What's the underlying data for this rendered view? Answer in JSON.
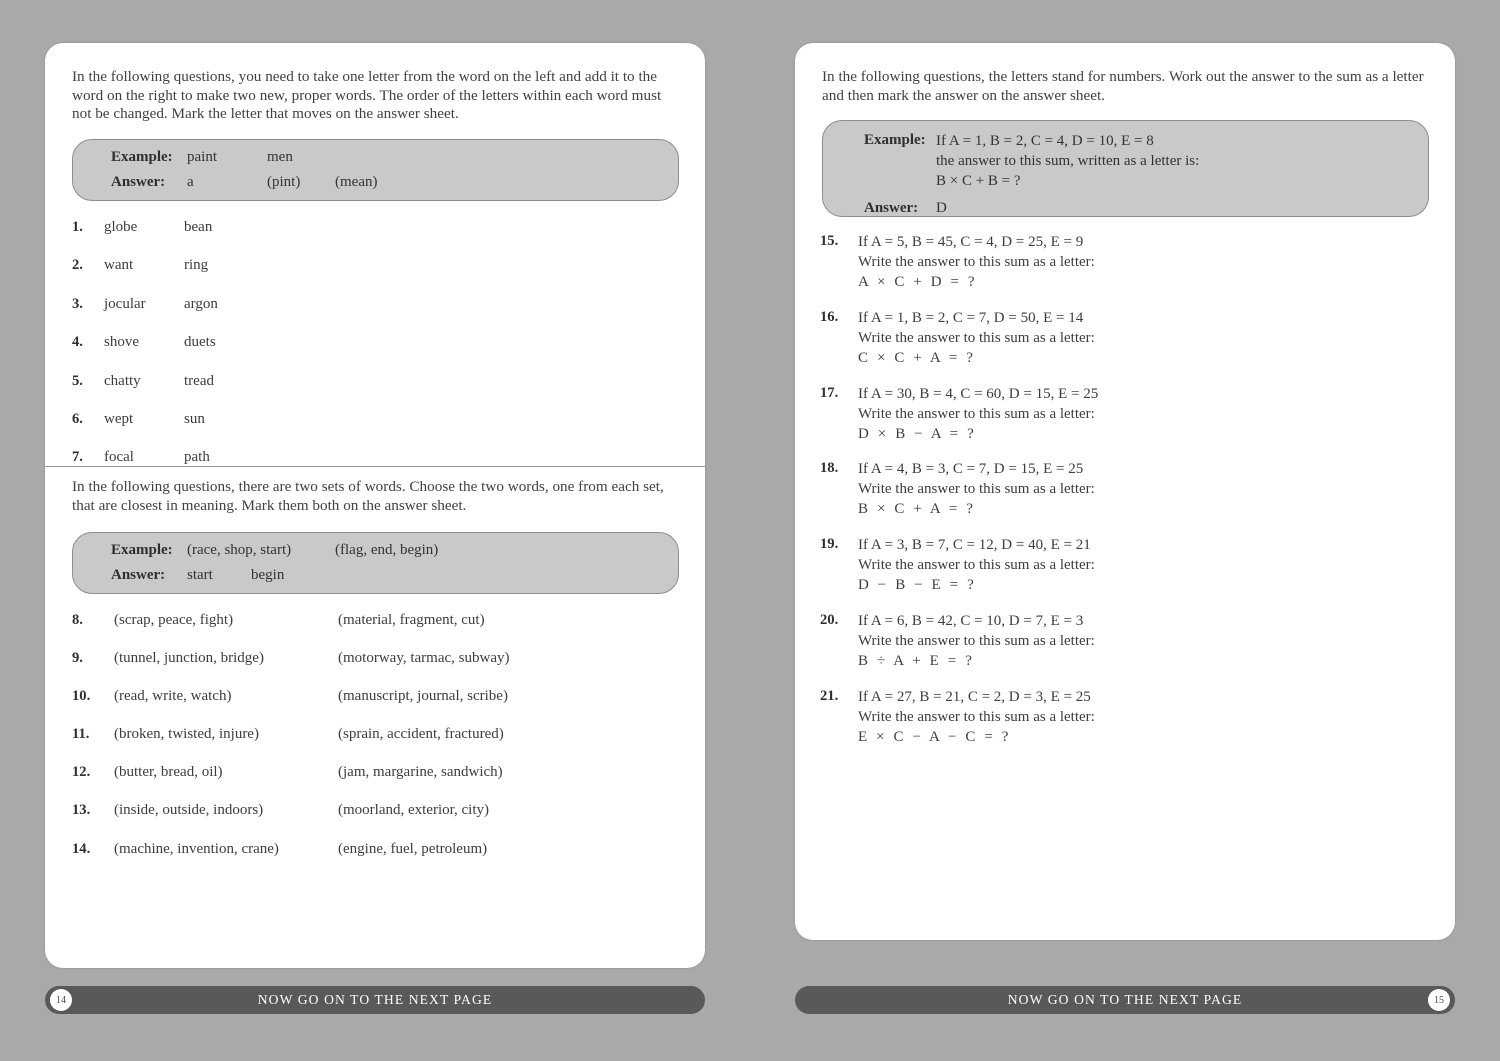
{
  "background_color": "#a9a9a9",
  "left_page": {
    "page_number": "14",
    "footer_text": "NOW GO ON TO THE NEXT PAGE",
    "section_a": {
      "instructions": "In the following questions, you need to take one letter from the word on the left and add it to the word on the right to make two new, proper words. The order of the letters within each word must not be changed. Mark the letter that moves on the answer sheet.",
      "example": {
        "example_label": "Example:",
        "example_word_1": "paint",
        "example_word_2": "men",
        "answer_label": "Answer:",
        "answer_letter": "a",
        "answer_word_1": "(pint)",
        "answer_word_2": "(mean)"
      },
      "questions": [
        {
          "num": "1.",
          "word_a": "globe",
          "word_b": "bean"
        },
        {
          "num": "2.",
          "word_a": "want",
          "word_b": "ring"
        },
        {
          "num": "3.",
          "word_a": "jocular",
          "word_b": "argon"
        },
        {
          "num": "4.",
          "word_a": "shove",
          "word_b": "duets"
        },
        {
          "num": "5.",
          "word_a": "chatty",
          "word_b": "tread"
        },
        {
          "num": "6.",
          "word_a": "wept",
          "word_b": "sun"
        },
        {
          "num": "7.",
          "word_a": "focal",
          "word_b": "path"
        }
      ]
    },
    "section_b": {
      "instructions": "In the following questions, there are two sets of words. Choose the two words, one from each set, that are closest in meaning. Mark them both on the answer sheet.",
      "example": {
        "example_label": "Example:",
        "example_set_1": "(race, shop, start)",
        "example_set_2": "(flag, end, begin)",
        "answer_label": "Answer:",
        "answer_word_1": "start",
        "answer_word_2": "begin"
      },
      "questions": [
        {
          "num": "8.",
          "set_a": "(scrap, peace, fight)",
          "set_b": "(material, fragment, cut)"
        },
        {
          "num": "9.",
          "set_a": "(tunnel, junction, bridge)",
          "set_b": "(motorway, tarmac, subway)"
        },
        {
          "num": "10.",
          "set_a": "(read, write, watch)",
          "set_b": "(manuscript, journal, scribe)"
        },
        {
          "num": "11.",
          "set_a": "(broken, twisted, injure)",
          "set_b": "(sprain, accident, fractured)"
        },
        {
          "num": "12.",
          "set_a": "(butter, bread, oil)",
          "set_b": "(jam, margarine, sandwich)"
        },
        {
          "num": "13.",
          "set_a": "(inside, outside, indoors)",
          "set_b": "(moorland, exterior, city)"
        },
        {
          "num": "14.",
          "set_a": "(machine, invention, crane)",
          "set_b": "(engine, fuel, petroleum)"
        }
      ]
    }
  },
  "right_page": {
    "page_number": "15",
    "footer_text": "NOW GO ON TO THE NEXT PAGE",
    "section_c": {
      "instructions": "In the following questions, the letters stand for numbers. Work out the answer to the sum as a letter and then mark the answer on the answer sheet.",
      "example": {
        "example_label": "Example:",
        "example_line_1": "If A = 1, B = 2, C = 4, D = 10, E = 8",
        "example_line_2": "the answer to this sum, written as a letter is:",
        "example_line_3": "B × C + B = ?",
        "answer_label": "Answer:",
        "answer_letter": "D"
      },
      "prompt_line": "Write the answer to this sum as a letter:",
      "questions": [
        {
          "num": "15.",
          "values": "If A = 5, B = 45, C = 4, D = 25, E = 9",
          "prompt": "Write the answer to this sum as a letter:",
          "formula": "A × C + D = ?"
        },
        {
          "num": "16.",
          "values": "If A = 1, B = 2, C = 7, D = 50, E = 14",
          "prompt": "Write the answer to this sum as a letter:",
          "formula": "C × C + A = ?"
        },
        {
          "num": "17.",
          "values": "If A = 30, B = 4, C = 60, D = 15, E = 25",
          "prompt": "Write the answer to this sum as a letter:",
          "formula": "D × B − A = ?"
        },
        {
          "num": "18.",
          "values": "If A = 4, B = 3, C = 7, D = 15, E = 25",
          "prompt": "Write the answer to this sum as a letter:",
          "formula": "B × C + A = ?"
        },
        {
          "num": "19.",
          "values": "If A = 3, B = 7, C = 12, D = 40, E = 21",
          "prompt": "Write the answer to this sum as a letter:",
          "formula": "D − B − E = ?"
        },
        {
          "num": "20.",
          "values": "If A = 6, B = 42, C = 10, D = 7, E = 3",
          "prompt": "Write the answer to this sum as a letter:",
          "formula": "B ÷ A + E = ?"
        },
        {
          "num": "21.",
          "values": "If A = 27, B = 21, C = 2, D = 3, E = 25",
          "prompt": "Write the answer to this sum as a letter:",
          "formula": "E × C − A − C = ?"
        }
      ]
    }
  }
}
